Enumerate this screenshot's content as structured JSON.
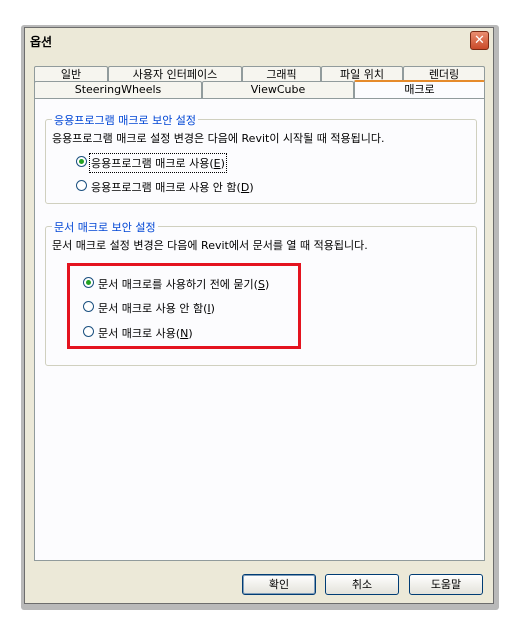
{
  "window": {
    "title": "옵션",
    "close_glyph": "✕"
  },
  "tabs_row1": [
    "일반",
    "사용자 인터페이스",
    "그래픽",
    "파일 위치",
    "렌더링"
  ],
  "tabs_row2": [
    "SteeringWheels",
    "ViewCube",
    "매크로"
  ],
  "active_tab": "매크로",
  "app_macro": {
    "title": "응용프로그램 매크로 보안 설정",
    "description": "응용프로그램 매크로 설정 변경은 다음에 Revit이 시작될 때 적용됩니다.",
    "options": [
      {
        "label": "응용프로그램 매크로 사용",
        "key": "E",
        "checked": true
      },
      {
        "label": "응용프로그램 매크로 사용 안 함",
        "key": "D",
        "checked": false
      }
    ]
  },
  "doc_macro": {
    "title": "문서 매크로 보안 설정",
    "description": "문서 매크로 설정 변경은 다음에 Revit에서 문서를 열 때 적용됩니다.",
    "options": [
      {
        "label": "문서 매크로를 사용하기 전에 묻기",
        "key": "S",
        "checked": true
      },
      {
        "label": "문서 매크로 사용 안 함",
        "key": "I",
        "checked": false
      },
      {
        "label": "문서 매크로 사용",
        "key": "N",
        "checked": false
      }
    ]
  },
  "buttons": {
    "ok": "확인",
    "cancel": "취소",
    "help": "도움말"
  },
  "colors": {
    "highlight": "#e4131f",
    "group_title": "#0046d5",
    "tab_accent": "#e68b2c"
  }
}
